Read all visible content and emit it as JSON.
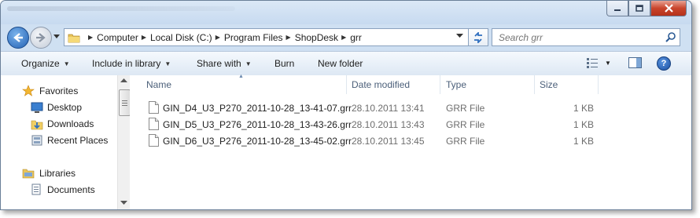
{
  "address": {
    "crumbs": [
      "Computer",
      "Local Disk (C:)",
      "Program Files",
      "ShopDesk",
      "grr"
    ]
  },
  "search": {
    "placeholder": "Search grr"
  },
  "toolbar": {
    "organize": "Organize",
    "include_in_library": "Include in library",
    "share_with": "Share with",
    "burn": "Burn",
    "new_folder": "New folder"
  },
  "nav": {
    "favorites": "Favorites",
    "desktop": "Desktop",
    "downloads": "Downloads",
    "recent_places": "Recent Places",
    "libraries": "Libraries",
    "documents": "Documents"
  },
  "columns": {
    "name": "Name",
    "date_modified": "Date modified",
    "type": "Type",
    "size": "Size"
  },
  "files": [
    {
      "name": "GIN_D4_U3_P270_2011-10-28_13-41-07.grr",
      "date": "28.10.2011 13:41",
      "type": "GRR File",
      "size": "1 KB"
    },
    {
      "name": "GIN_D5_U3_P276_2011-10-28_13-43-26.grr",
      "date": "28.10.2011 13:43",
      "type": "GRR File",
      "size": "1 KB"
    },
    {
      "name": "GIN_D6_U3_P276_2011-10-28_13-45-02.grr",
      "date": "28.10.2011 13:45",
      "type": "GRR File",
      "size": "1 KB"
    }
  ],
  "colors": {
    "frame": "#cfe0f2",
    "close_button": "#c9452c",
    "header_text": "#4c607a"
  }
}
